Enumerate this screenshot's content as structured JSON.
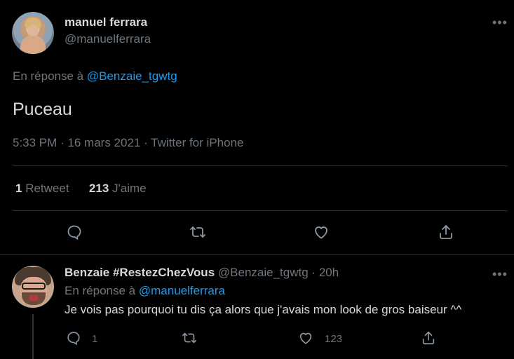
{
  "main_tweet": {
    "author_name": "manuel ferrara",
    "author_handle": "@manuelferrara",
    "more_label": "•••",
    "reply_prefix": "En réponse à",
    "reply_to": "@Benzaie_tgwtg",
    "text": "Puceau",
    "timestamp": "5:33 PM · 16 mars 2021 · Twitter for iPhone",
    "stats": {
      "retweets_count": "1",
      "retweets_label": "Retweet",
      "likes_count": "213",
      "likes_label": "J'aime"
    }
  },
  "reply_tweet": {
    "author_name": "Benzaie #RestezChezVous",
    "author_handle": "@Benzaie_tgwtg",
    "separator": "·",
    "age": "20h",
    "more_label": "•••",
    "reply_prefix": "En réponse à",
    "reply_to": "@manuelferrara",
    "text": "Je vois pas pourquoi tu dis ça alors que j'avais mon look de gros baiseur ^^",
    "reply_count": "1",
    "like_count": "123"
  },
  "icons": [
    "reply-icon",
    "retweet-icon",
    "like-icon",
    "share-icon"
  ],
  "colors": {
    "background": "#000000",
    "text": "#d9d9d9",
    "muted": "#6e767d",
    "link": "#1d9bf0",
    "divider": "#2f3336"
  }
}
